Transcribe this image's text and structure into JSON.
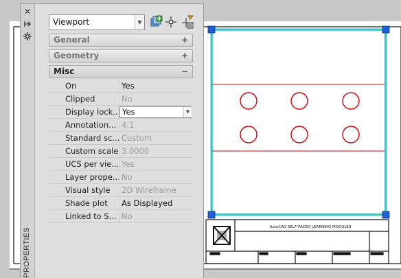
{
  "palette": {
    "title": "PROPERTIES",
    "object_type": "Viewport",
    "strip_buttons": [
      {
        "name": "close-icon",
        "glyph": "✕"
      },
      {
        "name": "auto-hide-icon",
        "glyph": "⇹"
      },
      {
        "name": "properties-settings-icon",
        "glyph": "✲"
      }
    ],
    "categories": {
      "general": {
        "label": "General",
        "sign": "+"
      },
      "geometry": {
        "label": "Geometry",
        "sign": "+"
      },
      "misc": {
        "label": "Misc",
        "sign": "−"
      }
    },
    "rows": [
      {
        "label": "On",
        "value": "Yes",
        "readonly": false,
        "editing": false
      },
      {
        "label": "Clipped",
        "value": "No",
        "readonly": true,
        "editing": false
      },
      {
        "label": "Display lock...",
        "value": "Yes",
        "readonly": false,
        "editing": true
      },
      {
        "label": "Annotation...",
        "value": "4:1",
        "readonly": true,
        "editing": false
      },
      {
        "label": "Standard sc...",
        "value": "Custom",
        "readonly": true,
        "editing": false
      },
      {
        "label": "Custom scale",
        "value": "3.0000",
        "readonly": true,
        "editing": false
      },
      {
        "label": "UCS per vie...",
        "value": "Yes",
        "readonly": true,
        "editing": false
      },
      {
        "label": "Layer prope...",
        "value": "No",
        "readonly": true,
        "editing": false
      },
      {
        "label": "Visual style",
        "value": "2D Wireframe",
        "readonly": true,
        "editing": false
      },
      {
        "label": "Shade plot",
        "value": "As Displayed",
        "readonly": false,
        "editing": false
      },
      {
        "label": "Linked to S...",
        "value": "No",
        "readonly": true,
        "editing": false
      }
    ],
    "toolbar_icons": [
      "toggle-pickadd-icon",
      "select-objects-icon",
      "quick-select-icon"
    ]
  },
  "drawing": {
    "title_block_text": "AutoCAD SELF-PACED LEARNING MODULES",
    "colors": {
      "viewport_border": "#3cc4c4",
      "grip": "#1f5fd6",
      "center_lines": "#d00000",
      "circles": "#d00000",
      "paper_line": "#000000"
    }
  }
}
